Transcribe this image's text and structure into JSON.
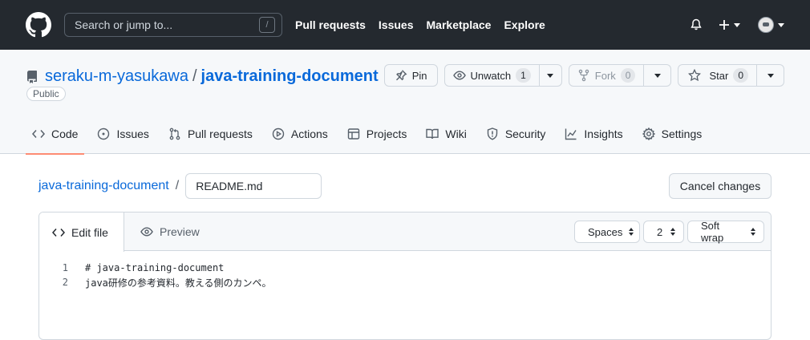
{
  "header": {
    "search_placeholder": "Search or jump to...",
    "search_shortcut": "/",
    "nav": [
      "Pull requests",
      "Issues",
      "Marketplace",
      "Explore"
    ]
  },
  "repo": {
    "owner": "seraku-m-yasukawa",
    "separator": "/",
    "name": "java-training-document",
    "visibility": "Public",
    "pin_label": "Pin",
    "unwatch_label": "Unwatch",
    "watch_count": "1",
    "fork_label": "Fork",
    "fork_count": "0",
    "star_label": "Star",
    "star_count": "0"
  },
  "tabs": [
    {
      "label": "Code",
      "icon": "code-icon"
    },
    {
      "label": "Issues",
      "icon": "issue-icon"
    },
    {
      "label": "Pull requests",
      "icon": "pull-request-icon"
    },
    {
      "label": "Actions",
      "icon": "play-icon"
    },
    {
      "label": "Projects",
      "icon": "table-icon"
    },
    {
      "label": "Wiki",
      "icon": "book-icon"
    },
    {
      "label": "Security",
      "icon": "shield-icon"
    },
    {
      "label": "Insights",
      "icon": "graph-icon"
    },
    {
      "label": "Settings",
      "icon": "gear-icon"
    }
  ],
  "editor": {
    "breadcrumb_repo": "java-training-document",
    "breadcrumb_sep": "/",
    "filename": "README.md",
    "cancel_label": "Cancel changes",
    "edit_tab": "Edit file",
    "preview_tab": "Preview",
    "indent_mode": "Spaces",
    "indent_size": "2",
    "wrap_mode": "Soft wrap",
    "lines": [
      {
        "num": "1",
        "text": "# java-training-document"
      },
      {
        "num": "2",
        "text": "java研修の参考資料。教える側のカンペ。"
      }
    ]
  },
  "colors": {
    "header_bg": "#24292f",
    "link": "#0969da",
    "active_tab_underline": "#fd8c73"
  }
}
